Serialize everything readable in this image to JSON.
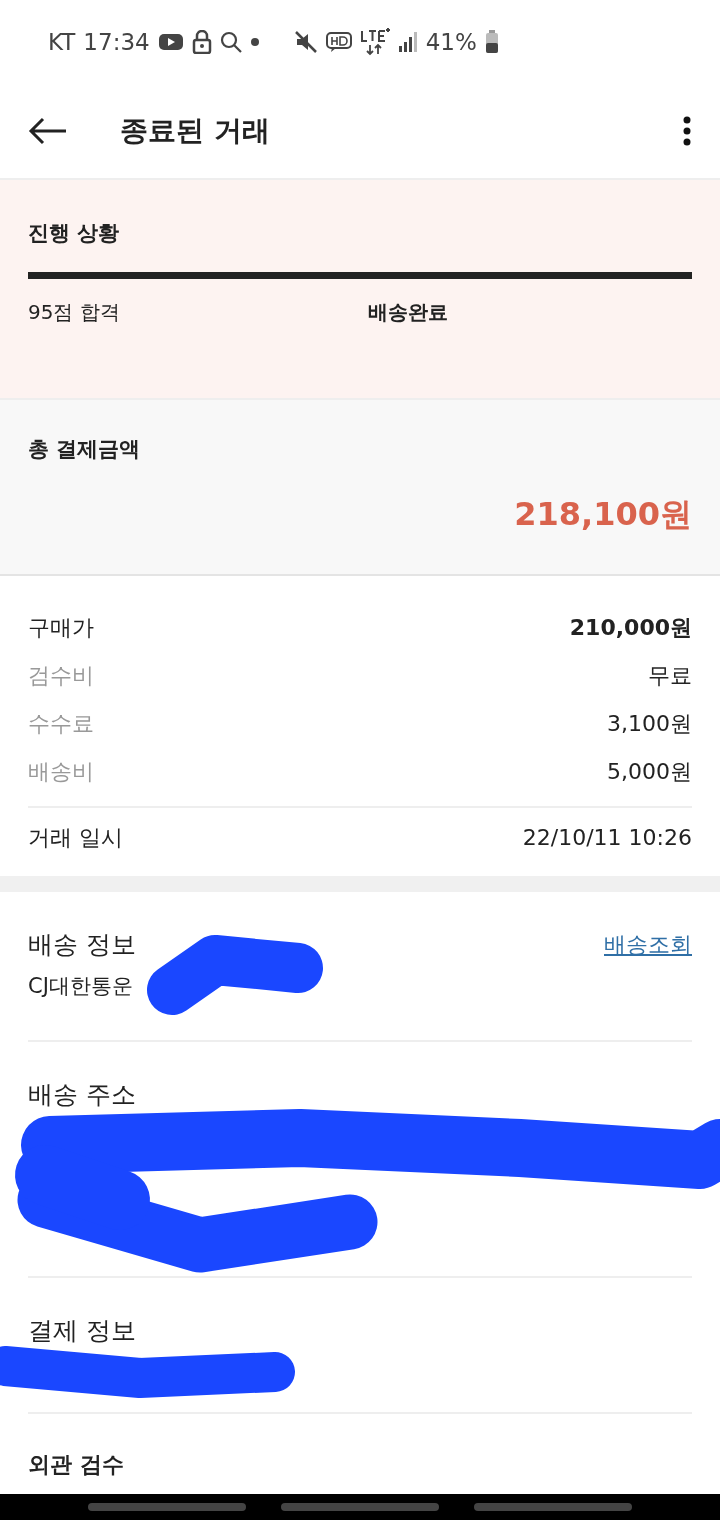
{
  "status_bar": {
    "carrier": "KT",
    "time": "17:34",
    "battery": "41%"
  },
  "header": {
    "title": "종료된 거래"
  },
  "progress": {
    "title": "진행 상황",
    "level": 1,
    "steps": [
      {
        "label": "95점 합격",
        "selected": false
      },
      {
        "label": "배송완료",
        "selected": true
      }
    ]
  },
  "total": {
    "label": "총 결제금액",
    "amount": "218,100원"
  },
  "price_rows": [
    {
      "label": "구매가",
      "value": "210,000원",
      "kind": "main"
    },
    {
      "label": "검수비",
      "value": "무료",
      "kind": "sub"
    },
    {
      "label": "수수료",
      "value": "3,100원",
      "kind": "sub"
    },
    {
      "label": "배송비",
      "value": "5,000원",
      "kind": "sub"
    }
  ],
  "trade_date": {
    "label": "거래 일시",
    "value": "22/10/11 10:26"
  },
  "sections": [
    {
      "title": "배송 정보",
      "link": "배송조회",
      "detail": "CJ대한통운"
    },
    {
      "title": "배송 주소"
    },
    {
      "title": "결제 정보"
    },
    {
      "title": "외관 검수",
      "kind": "bold"
    }
  ]
}
